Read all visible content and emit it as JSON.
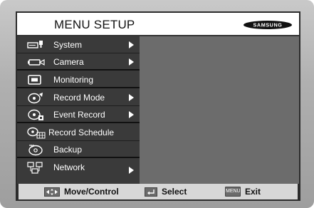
{
  "header": {
    "title": "MENU SETUP",
    "brand": "SAMSUNG"
  },
  "menu": {
    "items": [
      {
        "label": "System",
        "icon": "system-icon",
        "has_submenu": true
      },
      {
        "label": "Camera",
        "icon": "camera-icon",
        "has_submenu": true
      },
      {
        "label": "Monitoring",
        "icon": "monitor-icon",
        "has_submenu": false
      },
      {
        "label": "Record Mode",
        "icon": "record-mode-icon",
        "has_submenu": true
      },
      {
        "label": "Event Record",
        "icon": "event-record-icon",
        "has_submenu": true
      },
      {
        "label": "Record Schedule",
        "icon": "record-schedule-icon",
        "has_submenu": false
      },
      {
        "label": "Backup",
        "icon": "backup-icon",
        "has_submenu": false
      },
      {
        "label": "Network",
        "icon": "network-icon",
        "has_submenu": true
      }
    ]
  },
  "footer": {
    "move_label": "Move/Control",
    "select_label": "Select",
    "exit_label": "Exit",
    "exit_key": "MENU"
  },
  "colors": {
    "menu_background": "#3a3a3a",
    "content_background": "#6c6c6c",
    "header_background": "#ffffff",
    "footer_background": "#d7d7d7"
  }
}
